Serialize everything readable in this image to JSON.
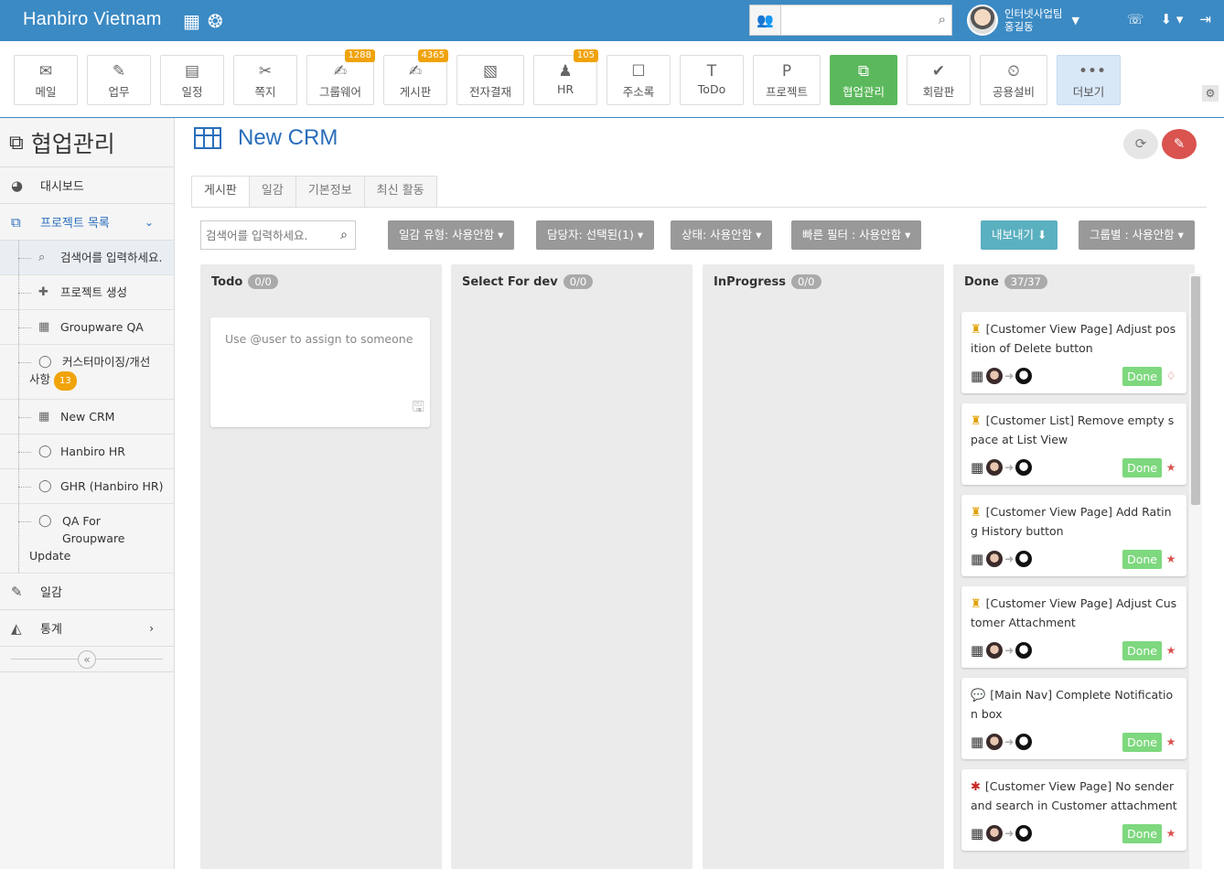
{
  "header": {
    "brand": "Hanbiro Vietnam",
    "search_placeholder": "",
    "user_team": "인터넷사업팀",
    "user_name": "홍길동"
  },
  "apps": [
    {
      "label": "메일",
      "icon": "mail-icon",
      "badge": ""
    },
    {
      "label": "업무",
      "icon": "task-icon",
      "badge": ""
    },
    {
      "label": "일정",
      "icon": "calendar-icon",
      "badge": ""
    },
    {
      "label": "쪽지",
      "icon": "memo-icon",
      "badge": ""
    },
    {
      "label": "그룹웨어",
      "icon": "groupware-icon",
      "badge": "1288"
    },
    {
      "label": "게시판",
      "icon": "board-icon",
      "badge": "4365"
    },
    {
      "label": "전자결재",
      "icon": "approval-icon",
      "badge": ""
    },
    {
      "label": "HR",
      "icon": "hr-icon",
      "badge": "105"
    },
    {
      "label": "주소록",
      "icon": "contacts-icon",
      "badge": ""
    },
    {
      "label": "ToDo",
      "icon": "todo-icon",
      "badge": ""
    },
    {
      "label": "프로젝트",
      "icon": "project-icon",
      "badge": ""
    },
    {
      "label": "협업관리",
      "icon": "collab-icon",
      "badge": ""
    },
    {
      "label": "회람판",
      "icon": "circular-icon",
      "badge": ""
    },
    {
      "label": "공용설비",
      "icon": "facility-icon",
      "badge": ""
    },
    {
      "label": "더보기",
      "icon": "more-icon",
      "badge": ""
    }
  ],
  "sidebar": {
    "title": "협업관리",
    "dashboard": "대시보드",
    "project_list": "프로젝트 목록",
    "subs": {
      "search": "검색어를 입력하세요.",
      "create": "프로젝트 생성",
      "groupware_qa": "Groupware QA",
      "custom_line1": "커스터마이징/개선",
      "custom_line2": "사항",
      "custom_count": "13",
      "new_crm": "New CRM",
      "hanbiro_hr": "Hanbiro HR",
      "ghr": "GHR (Hanbiro HR)",
      "qa_line1": "QA For Groupware",
      "qa_line2": "Update"
    },
    "diary": "일감",
    "stats": "통계"
  },
  "main": {
    "title": "New CRM",
    "tabs": [
      "게시판",
      "일감",
      "기본정보",
      "최신 활동"
    ],
    "search_placeholder": "검색어를 입력하세요.",
    "filters": {
      "type": "일감 유형: 사용안함",
      "assignee": "담당자: 선택된(1)",
      "status": "상태: 사용안함",
      "quick": "빠른 필터 : 사용안함",
      "export": "내보내기",
      "group": "그룹별 : 사용안함"
    },
    "columns": [
      {
        "name": "Todo",
        "count": "0/0"
      },
      {
        "name": "Select For dev",
        "count": "0/0"
      },
      {
        "name": "InProgress",
        "count": "0/0"
      },
      {
        "name": "Done",
        "count": "37/37"
      }
    ],
    "new_card_placeholder": "Use @user to assign to someone",
    "cards": [
      {
        "title": "[Customer View Page] Adjust position of Delete button",
        "icon": "crown-icon",
        "status": "Done",
        "priority": "diamond-icon"
      },
      {
        "title": "[Customer List] Remove empty space at List View",
        "icon": "crown-icon",
        "status": "Done",
        "priority": "star-icon"
      },
      {
        "title": "[Customer View Page] Add Rating History button",
        "icon": "crown-icon",
        "status": "Done",
        "priority": "star-icon"
      },
      {
        "title": "[Customer View Page] Adjust Customer Attachment",
        "icon": "crown-icon",
        "status": "Done",
        "priority": "star-icon"
      },
      {
        "title": "[Main Nav] Complete Notification box",
        "icon": "chat-icon",
        "status": "Done",
        "priority": "star-icon"
      },
      {
        "title": "[Customer View Page] No sender and search in Customer attachment",
        "icon": "bug-icon",
        "status": "Done",
        "priority": "star-icon"
      }
    ]
  },
  "colors": {
    "topbar": "#3b8ac4",
    "active_app": "#5cb85c",
    "done": "#7ed87e",
    "badge": "#f0a30a"
  }
}
